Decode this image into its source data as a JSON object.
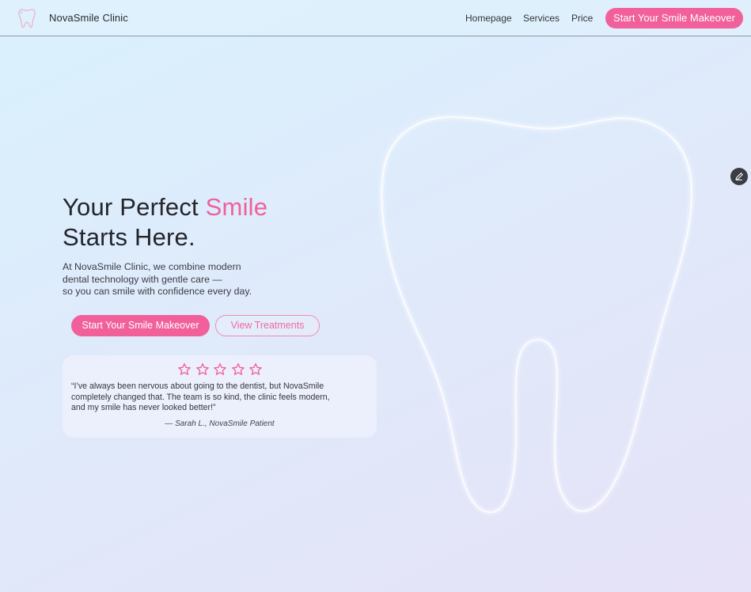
{
  "header": {
    "brand": "NovaSmile Clinic",
    "logo_icon": "tooth-icon",
    "nav": [
      {
        "label": "Homepage"
      },
      {
        "label": "Services"
      },
      {
        "label": "Price"
      }
    ],
    "cta_label": "Start Your Smile Makeover"
  },
  "hero": {
    "title_line1_prefix": "Your Perfect ",
    "title_line1_accent": "Smile",
    "title_line2": "Starts Here.",
    "description_lines": [
      "At NovaSmile Clinic, we combine modern",
      "dental technology with gentle care —",
      "so you can smile with confidence every day."
    ],
    "primary_button": "Start Your Smile Makeover",
    "secondary_button": "View Treatments"
  },
  "testimonial": {
    "rating": 5,
    "rating_max": 5,
    "quote_lines": [
      "“I’ve always been nervous about going to the dentist, but NovaSmile",
      "completely changed that. The team is so kind, the clinic feels modern,",
      "and my smile has never looked better!”"
    ],
    "author": "— Sarah L., NovaSmile Patient"
  },
  "decor": {
    "background_icon": "tooth-outline-icon",
    "edit_icon": "pencil-icon"
  },
  "colors": {
    "accent": "#f1609b",
    "accent_outline": "#f08ab3",
    "text": "#25252b",
    "header_border": "#8c9aa6"
  }
}
